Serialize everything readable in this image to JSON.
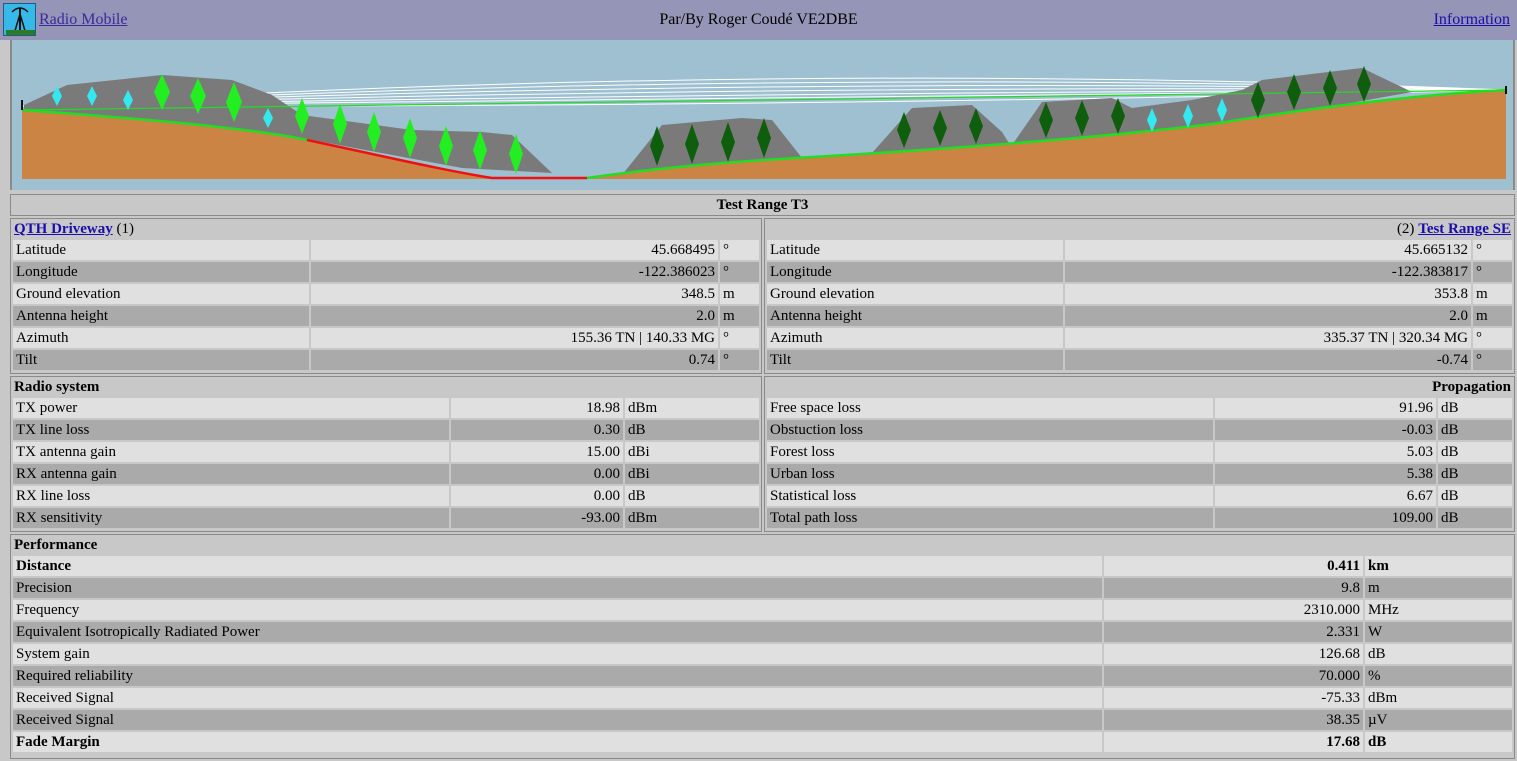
{
  "header": {
    "app_link": "Radio Mobile",
    "author": "Par/By Roger Coudé VE2DBE",
    "info_link": "Information",
    "logo_icon": "radio-tower-icon"
  },
  "path_title": "Test Range T3",
  "site1": {
    "name": "QTH Driveway",
    "index": "(1)",
    "rows": [
      {
        "label": "Latitude",
        "value": "45.668495",
        "unit": "°"
      },
      {
        "label": "Longitude",
        "value": "-122.386023",
        "unit": "°"
      },
      {
        "label": "Ground elevation",
        "value": "348.5",
        "unit": "m"
      },
      {
        "label": "Antenna height",
        "value": "2.0",
        "unit": "m"
      },
      {
        "label": "Azimuth",
        "value": "155.36 TN | 140.33 MG",
        "unit": "°"
      },
      {
        "label": "Tilt",
        "value": "0.74",
        "unit": "°"
      }
    ]
  },
  "site2": {
    "name": "Test Range SE",
    "index": "(2)",
    "rows": [
      {
        "label": "Latitude",
        "value": "45.665132",
        "unit": "°"
      },
      {
        "label": "Longitude",
        "value": "-122.383817",
        "unit": "°"
      },
      {
        "label": "Ground elevation",
        "value": "353.8",
        "unit": "m"
      },
      {
        "label": "Antenna height",
        "value": "2.0",
        "unit": "m"
      },
      {
        "label": "Azimuth",
        "value": "335.37 TN | 320.34 MG",
        "unit": "°"
      },
      {
        "label": "Tilt",
        "value": "-0.74",
        "unit": "°"
      }
    ]
  },
  "radio_system": {
    "title": "Radio system",
    "rows": [
      {
        "label": "TX power",
        "value": "18.98",
        "unit": "dBm"
      },
      {
        "label": "TX line loss",
        "value": "0.30",
        "unit": "dB"
      },
      {
        "label": "TX antenna gain",
        "value": "15.00",
        "unit": "dBi"
      },
      {
        "label": "RX antenna gain",
        "value": "0.00",
        "unit": "dBi"
      },
      {
        "label": "RX line loss",
        "value": "0.00",
        "unit": "dB"
      },
      {
        "label": "RX sensitivity",
        "value": "-93.00",
        "unit": "dBm"
      }
    ]
  },
  "propagation": {
    "title": "Propagation",
    "rows": [
      {
        "label": "Free space loss",
        "value": "91.96",
        "unit": "dB"
      },
      {
        "label": "Obstuction loss",
        "value": "-0.03",
        "unit": "dB"
      },
      {
        "label": "Forest loss",
        "value": "5.03",
        "unit": "dB"
      },
      {
        "label": "Urban loss",
        "value": "5.38",
        "unit": "dB"
      },
      {
        "label": "Statistical loss",
        "value": "6.67",
        "unit": "dB"
      },
      {
        "label": "Total path loss",
        "value": "109.00",
        "unit": "dB"
      }
    ]
  },
  "performance": {
    "title": "Performance",
    "rows": [
      {
        "label": "Distance",
        "value": "0.411",
        "unit": "km"
      },
      {
        "label": "Precision",
        "value": "9.8",
        "unit": "m"
      },
      {
        "label": "Frequency",
        "value": "2310.000",
        "unit": "MHz"
      },
      {
        "label": "Equivalent Isotropically Radiated Power",
        "value": "2.331",
        "unit": "W"
      },
      {
        "label": "System gain",
        "value": "126.68",
        "unit": "dB"
      },
      {
        "label": "Required reliability",
        "value": "70.000",
        "unit": "%"
      },
      {
        "label": "Received Signal",
        "value": "-75.33",
        "unit": "dBm"
      },
      {
        "label": "Received Signal",
        "value": "38.35",
        "unit": "µV"
      },
      {
        "label": "Fade Margin",
        "value": "17.68",
        "unit": "dB"
      }
    ]
  },
  "colors": {
    "header_bg": "#9595b8",
    "sky": "#9ec0d0",
    "ground": "#cc8444",
    "clear_path": "#22dd22",
    "obstructed_path": "#ee1111",
    "forest_light": "#22ee22",
    "forest_dark": "#0e5e0e",
    "urban": "#33e8ee",
    "row_light": "#e0e0e0",
    "row_dark": "#aaaaaa"
  }
}
